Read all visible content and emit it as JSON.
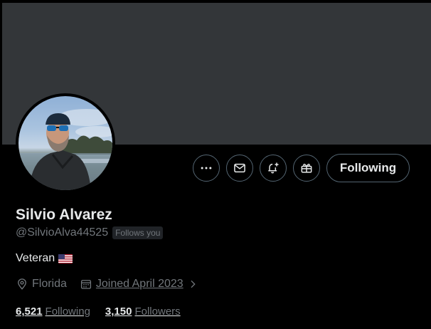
{
  "profile": {
    "name": "Silvio Alvarez",
    "handle": "@SilvioAlva44525",
    "follows_you": "Follows you",
    "bio": "Veteran",
    "bio_flag": "us-flag",
    "location": "Florida",
    "joined": "Joined April 2023",
    "following_count": "6,521",
    "following_label": "Following",
    "followers_count": "3,150",
    "followers_label": "Followers"
  },
  "actions": {
    "more_icon": "more-icon",
    "message_icon": "mail-icon",
    "notify_icon": "bell-plus-icon",
    "subscribe_icon": "gift-icon",
    "follow_state_label": "Following"
  },
  "colors": {
    "background": "#000000",
    "banner": "#333639",
    "primary_text": "#e7e9ea",
    "secondary_text": "#71767b",
    "border": "#536471"
  }
}
